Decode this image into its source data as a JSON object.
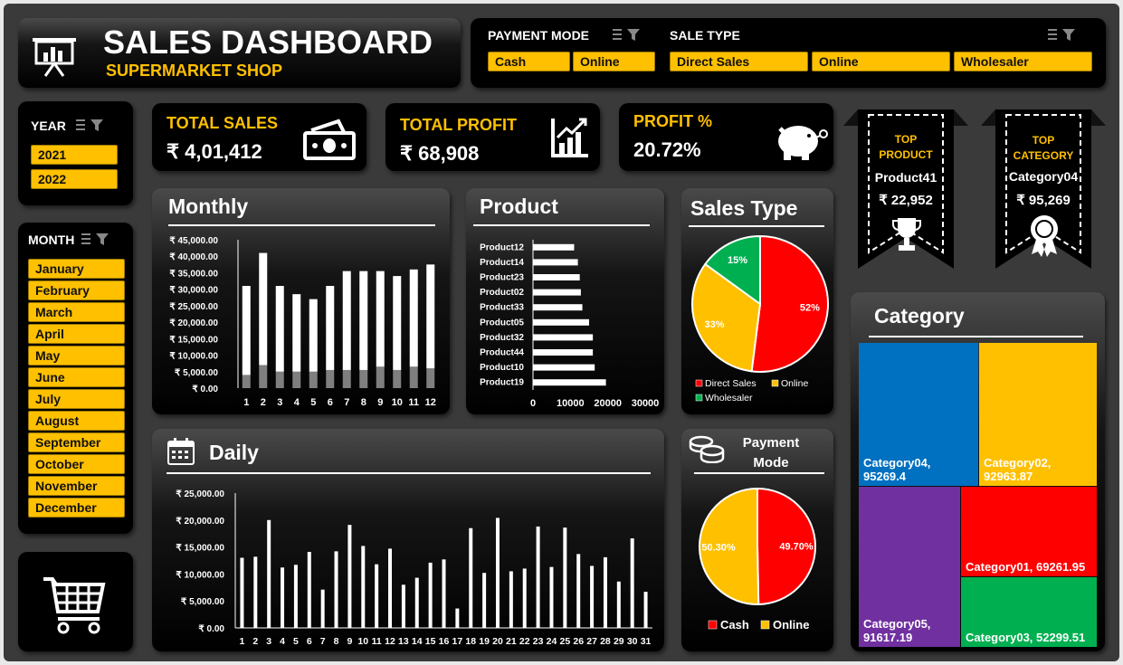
{
  "header": {
    "title": "SALES DASHBOARD",
    "subtitle": "SUPERMARKET SHOP"
  },
  "slicers": {
    "payment_mode": {
      "title": "PAYMENT MODE",
      "items": [
        "Cash",
        "Online"
      ]
    },
    "sale_type": {
      "title": "SALE TYPE",
      "items": [
        "Direct Sales",
        "Online",
        "Wholesaler"
      ]
    },
    "year": {
      "title": "YEAR",
      "items": [
        "2021",
        "2022"
      ]
    },
    "month": {
      "title": "MONTH",
      "items": [
        "January",
        "February",
        "March",
        "April",
        "May",
        "June",
        "July",
        "August",
        "September",
        "October",
        "November",
        "December"
      ]
    }
  },
  "kpis": {
    "total_sales": {
      "label": "TOTAL SALES",
      "value": "₹ 4,01,412"
    },
    "total_profit": {
      "label": "TOTAL  PROFIT",
      "value": "₹ 68,908"
    },
    "profit_pct": {
      "label": "PROFIT  %",
      "value": "20.72%"
    }
  },
  "top_product": {
    "label1": "TOP",
    "label2": "PRODUCT",
    "name": "Product41",
    "value": "₹ 22,952"
  },
  "top_category": {
    "label1": "TOP",
    "label2": "CATEGORY",
    "name": "Category04",
    "value": "₹ 95,269"
  },
  "titles": {
    "monthly": "Monthly",
    "product": "Product",
    "sales_type": "Sales Type",
    "daily": "Daily",
    "payment_mode": "Payment Mode",
    "category": "Category"
  },
  "colors": {
    "accent": "#ffc000",
    "red": "#ff0000",
    "green": "#00b050",
    "blue": "#0070c0",
    "purple": "#7030a0"
  },
  "chart_data": [
    {
      "id": "monthly",
      "type": "bar",
      "categories": [
        "1",
        "2",
        "3",
        "4",
        "5",
        "6",
        "7",
        "8",
        "9",
        "10",
        "11",
        "12"
      ],
      "series": [
        {
          "values": [
            4000,
            7000,
            5000,
            5000,
            5000,
            5500,
            5500,
            5500,
            6500,
            5500,
            6500,
            6000
          ]
        },
        {
          "values": [
            27000,
            34000,
            26000,
            23500,
            22000,
            25500,
            30000,
            30000,
            29000,
            28500,
            29500,
            31500
          ]
        }
      ],
      "ylim": [
        0,
        45000
      ],
      "yticks": [
        "₹ 0.00",
        "₹ 5,000.00",
        "₹ 10,000.00",
        "₹ 15,000.00",
        "₹ 20,000.00",
        "₹ 25,000.00",
        "₹ 30,000.00",
        "₹ 35,000.00",
        "₹ 40,000.00",
        "₹ 45,000.00"
      ],
      "stacked": true
    },
    {
      "id": "product",
      "type": "bar",
      "orientation": "horizontal",
      "categories": [
        "Product12",
        "Product14",
        "Product23",
        "Product02",
        "Product33",
        "Product05",
        "Product32",
        "Product44",
        "Product10",
        "Product19"
      ],
      "values": [
        11000,
        12000,
        12500,
        12800,
        13200,
        15000,
        16000,
        16000,
        16500,
        19500
      ],
      "xlim": [
        0,
        30000
      ],
      "xticks": [
        "0",
        "10000",
        "20000",
        "30000"
      ]
    },
    {
      "id": "sales_type",
      "type": "pie",
      "labels": [
        "Direct Sales",
        "Online",
        "Wholesaler"
      ],
      "values": [
        52,
        33,
        15
      ],
      "value_labels": [
        "52%",
        "33%",
        "15%"
      ],
      "colors": [
        "#ff0000",
        "#ffc000",
        "#00b050"
      ]
    },
    {
      "id": "daily",
      "type": "bar",
      "categories": [
        "1",
        "2",
        "3",
        "4",
        "5",
        "6",
        "7",
        "8",
        "9",
        "10",
        "11",
        "12",
        "13",
        "14",
        "15",
        "16",
        "17",
        "18",
        "19",
        "20",
        "21",
        "22",
        "23",
        "24",
        "25",
        "26",
        "27",
        "28",
        "29",
        "30",
        "31"
      ],
      "values": [
        13000,
        13200,
        20000,
        11200,
        11700,
        14100,
        7100,
        14200,
        19100,
        15200,
        11800,
        14700,
        8000,
        9300,
        12100,
        12700,
        3600,
        18500,
        10200,
        20400,
        10500,
        11000,
        18800,
        11300,
        18600,
        13700,
        11500,
        13100,
        8600,
        16600,
        6700
      ],
      "ylim": [
        0,
        25000
      ],
      "yticks": [
        "₹ 0.00",
        "₹ 5,000.00",
        "₹ 10,000.00",
        "₹ 15,000.00",
        "₹ 20,000.00",
        "₹ 25,000.00"
      ]
    },
    {
      "id": "payment_mode",
      "type": "pie",
      "labels": [
        "Cash",
        "Online"
      ],
      "values": [
        49.7,
        50.3
      ],
      "value_labels": [
        "49.70%",
        "50.30%"
      ],
      "colors": [
        "#ff0000",
        "#ffc000"
      ]
    },
    {
      "id": "category",
      "type": "treemap",
      "labels": [
        "Category04, 95269.4",
        "Category02, 92963.87",
        "Category05, 91617.19",
        "Category01, 69261.95",
        "Category03, 52299.51"
      ],
      "values": [
        95269.4,
        92963.87,
        91617.19,
        69261.95,
        52299.51
      ],
      "colors": [
        "#0070c0",
        "#ffc000",
        "#7030a0",
        "#ff0000",
        "#00b050"
      ]
    }
  ]
}
